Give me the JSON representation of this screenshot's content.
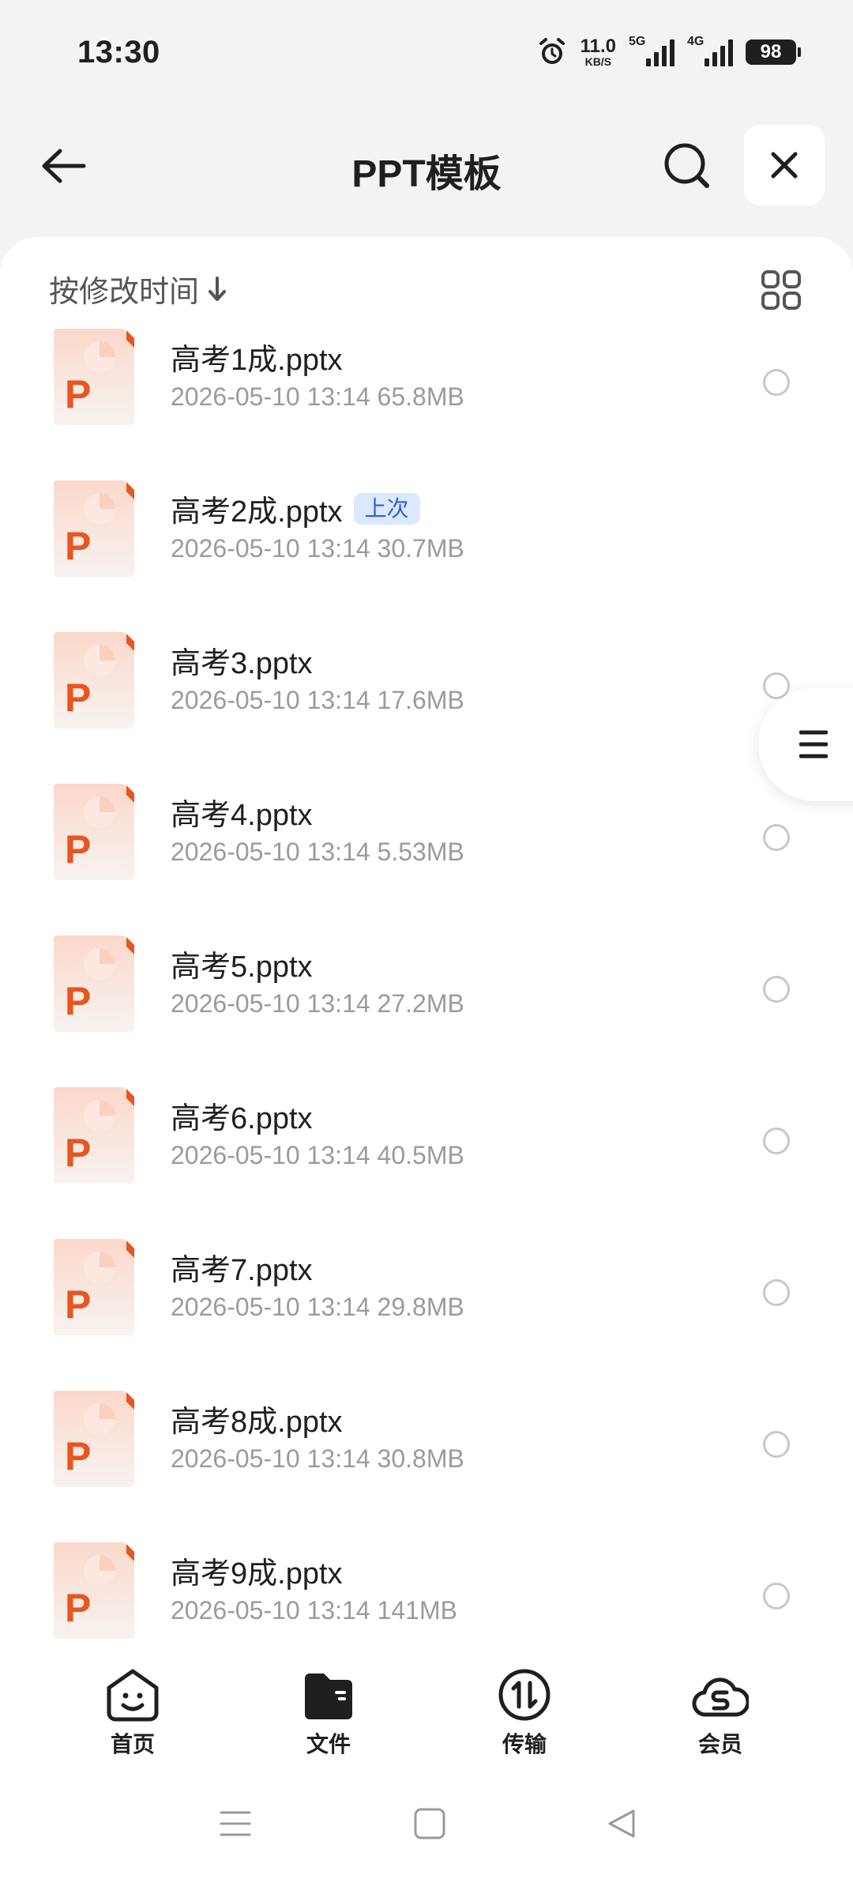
{
  "status_bar": {
    "time": "13:30",
    "net_speed_value": "11.0",
    "net_speed_unit": "KB/S",
    "signal1_label": "5G",
    "signal2_label": "4G",
    "battery": "98"
  },
  "header": {
    "title": "PPT模板",
    "icons": {
      "back": "back-arrow-icon",
      "search": "search-icon",
      "close": "close-icon"
    }
  },
  "sort": {
    "label": "按修改时间",
    "direction_icon": "arrow-down-icon",
    "view_icon": "grid-view-icon"
  },
  "files": [
    {
      "name": "高考1成.pptx",
      "date": "2026-05-10 13:14",
      "size": "65.8MB",
      "badge": ""
    },
    {
      "name": "高考2成.pptx",
      "date": "2026-05-10 13:14",
      "size": "30.7MB",
      "badge": "上次"
    },
    {
      "name": "高考3.pptx",
      "date": "2026-05-10 13:14",
      "size": "17.6MB",
      "badge": ""
    },
    {
      "name": "高考4.pptx",
      "date": "2026-05-10 13:14",
      "size": "5.53MB",
      "badge": ""
    },
    {
      "name": "高考5.pptx",
      "date": "2026-05-10 13:14",
      "size": "27.2MB",
      "badge": ""
    },
    {
      "name": "高考6.pptx",
      "date": "2026-05-10 13:14",
      "size": "40.5MB",
      "badge": ""
    },
    {
      "name": "高考7.pptx",
      "date": "2026-05-10 13:14",
      "size": "29.8MB",
      "badge": ""
    },
    {
      "name": "高考8成.pptx",
      "date": "2026-05-10 13:14",
      "size": "30.8MB",
      "badge": ""
    },
    {
      "name": "高考9成.pptx",
      "date": "2026-05-10 13:14",
      "size": "141MB",
      "badge": ""
    }
  ],
  "bottom_nav": [
    {
      "label": "首页",
      "icon": "home-face-icon"
    },
    {
      "label": "文件",
      "icon": "folder-icon",
      "active": true
    },
    {
      "label": "传输",
      "icon": "transfer-icon"
    },
    {
      "label": "会员",
      "icon": "vip-cloud-icon"
    }
  ],
  "colors": {
    "accent_blue": "#2a63d8",
    "badge_bg": "#dce8ff",
    "ppt_orange": "#e8551e",
    "text_primary": "#1f1f1f",
    "text_secondary": "#9b9b9b"
  }
}
